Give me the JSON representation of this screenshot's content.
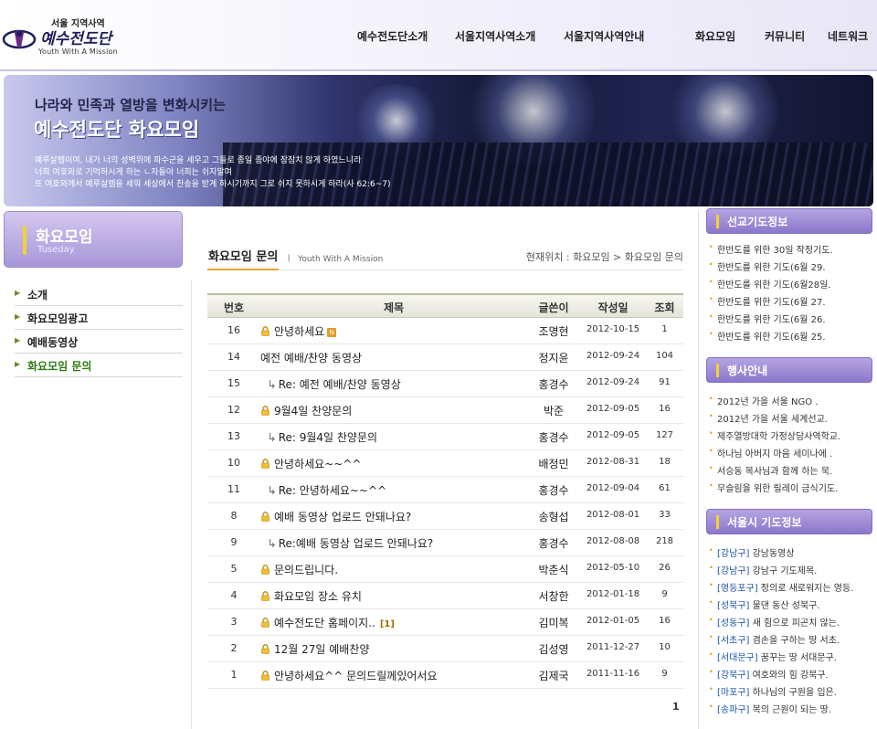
{
  "logo": {
    "top": "서울 지역사역",
    "main": "예수전도단",
    "sub": "Youth With A Mission"
  },
  "nav": [
    "예수전도단소개",
    "서울지역사역소개",
    "서울지역사역안내",
    "화요모임",
    "커뮤니티",
    "네트워크"
  ],
  "banner": {
    "line1": "나라와 민족과 열방을 변화시키는",
    "line2": "예수전도단 화요모임",
    "verse": [
      "예루살렘이여, 내가 너의 성벽위에 파수군을 세우고 그들로 종일 종야에 잠잠치 않게 하였느니라",
      "너희 여호와로 기억하시게 하는 ㄴ자들아 너희는 쉬지말며",
      "또 여호와께서 예루살렘을 세워 세상에서 찬송을 받게 하시기까지 그로 쉬지 못하시게 하라(사 62:6~7)"
    ]
  },
  "section": {
    "title": "화요모임",
    "subtitle": "Tuseday"
  },
  "left_nav": [
    {
      "label": "소개",
      "active": false
    },
    {
      "label": "화요모임광고",
      "active": false
    },
    {
      "label": "예배동영상",
      "active": false
    },
    {
      "label": "화요모임 문의",
      "active": true
    }
  ],
  "main": {
    "title": "화요모임 문의",
    "subtitle": "Youth With A Mission",
    "breadcrumb": "현재위치 : 화요모임 > 화요모임 문의"
  },
  "table": {
    "headers": [
      "번호",
      "제목",
      "글쓴이",
      "작성일",
      "조회"
    ],
    "rows": [
      {
        "no": "16",
        "title": "안녕하세요",
        "locked": true,
        "reply": false,
        "new": true,
        "comments": "",
        "author": "조명현",
        "date": "2012-10-15",
        "views": "1"
      },
      {
        "no": "14",
        "title": "예전 예배/찬양 동영상",
        "locked": false,
        "reply": false,
        "new": false,
        "comments": "",
        "author": "정지윤",
        "date": "2012-09-24",
        "views": "104"
      },
      {
        "no": "15",
        "title": "Re: 예전 예배/찬양 동영상",
        "locked": false,
        "reply": true,
        "new": false,
        "comments": "",
        "author": "홍경수",
        "date": "2012-09-24",
        "views": "91"
      },
      {
        "no": "12",
        "title": "9월4일 찬양문의",
        "locked": true,
        "reply": false,
        "new": false,
        "comments": "",
        "author": "박준",
        "date": "2012-09-05",
        "views": "16"
      },
      {
        "no": "13",
        "title": "Re: 9월4일 찬양문의",
        "locked": false,
        "reply": true,
        "new": false,
        "comments": "",
        "author": "홍경수",
        "date": "2012-09-05",
        "views": "127"
      },
      {
        "no": "10",
        "title": "안녕하세요~~^^",
        "locked": true,
        "reply": false,
        "new": false,
        "comments": "",
        "author": "배정민",
        "date": "2012-08-31",
        "views": "18"
      },
      {
        "no": "11",
        "title": "Re: 안녕하세요~~^^",
        "locked": false,
        "reply": true,
        "new": false,
        "comments": "",
        "author": "홍경수",
        "date": "2012-09-04",
        "views": "61"
      },
      {
        "no": "8",
        "title": "예배 동영상 업로드 안돼나요?",
        "locked": true,
        "reply": false,
        "new": false,
        "comments": "",
        "author": "송형섭",
        "date": "2012-08-01",
        "views": "33"
      },
      {
        "no": "9",
        "title": "Re:예배 동영상 업로드 안돼나요?",
        "locked": false,
        "reply": true,
        "new": false,
        "comments": "",
        "author": "홍경수",
        "date": "2012-08-08",
        "views": "218"
      },
      {
        "no": "5",
        "title": "문의드립니다.",
        "locked": true,
        "reply": false,
        "new": false,
        "comments": "",
        "author": "박춘식",
        "date": "2012-05-10",
        "views": "26"
      },
      {
        "no": "4",
        "title": "화요모임 장소 유치",
        "locked": true,
        "reply": false,
        "new": false,
        "comments": "",
        "author": "서창한",
        "date": "2012-01-18",
        "views": "9"
      },
      {
        "no": "3",
        "title": "예수전도단 홈페이지..",
        "locked": true,
        "reply": false,
        "new": false,
        "comments": "[1]",
        "author": "김미복",
        "date": "2012-01-05",
        "views": "16"
      },
      {
        "no": "2",
        "title": "12월 27일 예배찬양",
        "locked": true,
        "reply": false,
        "new": false,
        "comments": "",
        "author": "김성영",
        "date": "2011-12-27",
        "views": "10"
      },
      {
        "no": "1",
        "title": "안녕하세요^^ 문의드릴께있어서요",
        "locked": true,
        "reply": false,
        "new": false,
        "comments": "",
        "author": "김제국",
        "date": "2011-11-16",
        "views": "9"
      }
    ]
  },
  "pagination": {
    "current": "1"
  },
  "sidebar": {
    "boxes": [
      {
        "title": "선교기도정보",
        "items": [
          {
            "tag": "",
            "text": "한반도를 위한 30일 작정기도."
          },
          {
            "tag": "",
            "text": "한반도를 위한 기도(6월 29."
          },
          {
            "tag": "",
            "text": "한반도를 위한 기도(6월28일."
          },
          {
            "tag": "",
            "text": "한반도를 위한 기도(6월 27."
          },
          {
            "tag": "",
            "text": "한반도를 위한 기도(6월 26."
          },
          {
            "tag": "",
            "text": "한반도를 위한 기도(6월 25."
          }
        ]
      },
      {
        "title": "행사안내",
        "items": [
          {
            "tag": "",
            "text": "2012년 가을 서울 NGO ."
          },
          {
            "tag": "",
            "text": "2012년 가을 서울 세계선교."
          },
          {
            "tag": "",
            "text": "제주열방대학 가정상담사역학교."
          },
          {
            "tag": "",
            "text": "하나님 아버지 마음 세미나에 ."
          },
          {
            "tag": "",
            "text": "서승동 목사님과 함께 하는 묵."
          },
          {
            "tag": "",
            "text": "무슬림을 위한 릴레이 금식기도."
          }
        ]
      },
      {
        "title": "서울시 기도정보",
        "items": [
          {
            "tag": "[강남구]",
            "text": " 강남동영상"
          },
          {
            "tag": "[강남구]",
            "text": " 강남구 기도제목."
          },
          {
            "tag": "[영등포구]",
            "text": " 정의로 새로워지는 영등."
          },
          {
            "tag": "[성북구]",
            "text": " 물댄 동산 성북구."
          },
          {
            "tag": "[성동구]",
            "text": " 새 힘으로 피곤치 않는."
          },
          {
            "tag": "[서초구]",
            "text": " 겸손을 구하는 땅 서초."
          },
          {
            "tag": "[서대문구]",
            "text": " 꿈꾸는 땅 서대문구."
          },
          {
            "tag": "[강북구]",
            "text": " 여호와의 힘 강북구."
          },
          {
            "tag": "[마포구]",
            "text": " 하나님의 구원을 입은."
          },
          {
            "tag": "[송파구]",
            "text": " 복의 근원이 되는 땅."
          }
        ]
      }
    ]
  }
}
